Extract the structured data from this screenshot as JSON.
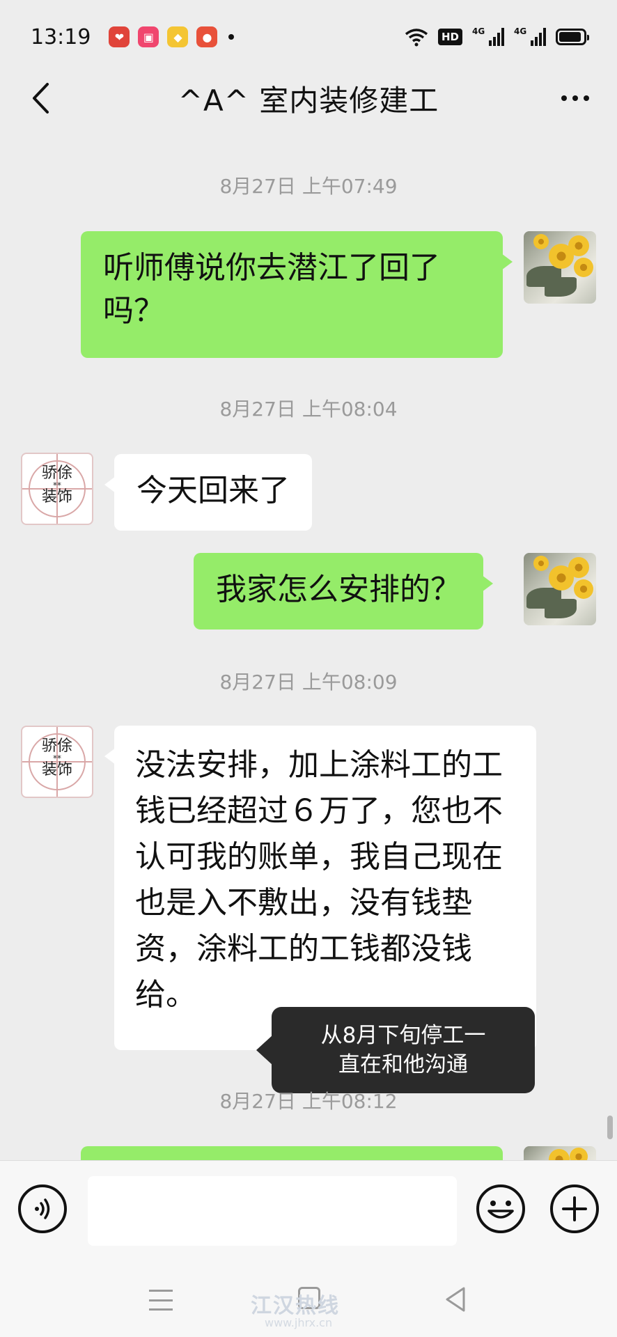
{
  "status_bar": {
    "time": "13:19",
    "notification_icons": [
      "heart-app-icon",
      "video-app-icon",
      "shield-app-icon",
      "cat-app-icon"
    ],
    "hd_label": "HD",
    "signal1_label": "4G",
    "signal2_label": "4G"
  },
  "header": {
    "title": "^A^ 室内装修建工",
    "back_icon": "chevron-left-icon",
    "more_icon": "more-dots-icon"
  },
  "timestamps": [
    "8月27日 上午07:49",
    "8月27日 上午08:04",
    "8月27日 上午08:09",
    "8月27日 上午08:12"
  ],
  "messages": [
    {
      "side": "right",
      "text": "听师傅说你去潜江了回了吗？"
    },
    {
      "side": "left",
      "text": "今天回来了"
    },
    {
      "side": "right",
      "text": "我家怎么安排的？"
    },
    {
      "side": "left",
      "text": "没法安排，加上涂料工的工钱已经超过６万了，您也不认可我的账单，我自己现在也是入不敷出，没有钱垫资，涂料工的工钱都没钱给。"
    }
  ],
  "avatar_other_text": {
    "line1": "骄俆",
    "stars": "**",
    "line2": "装饰"
  },
  "tooltip": {
    "line1": "从8月下旬停工一",
    "line2": "直在和他沟通"
  },
  "input_bar": {
    "placeholder": ""
  },
  "watermark": {
    "main": "江汉热线",
    "sub": "www.jhrx.cn"
  },
  "colors": {
    "background": "#ededed",
    "bubble_right": "#95ec69",
    "bubble_left": "#ffffff",
    "timestamp": "#9a9a9a",
    "tooltip_bg": "#2a2a2a"
  }
}
